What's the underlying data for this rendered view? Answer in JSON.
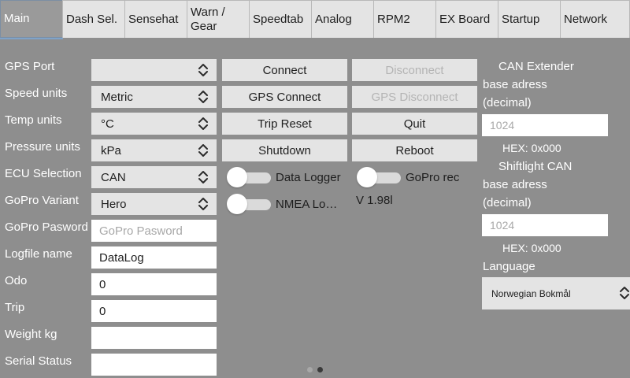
{
  "tabs": [
    {
      "label": "Main",
      "active": true
    },
    {
      "label": "Dash Sel.",
      "active": false
    },
    {
      "label": "Sensehat",
      "active": false
    },
    {
      "label": "Warn / Gear",
      "active": false
    },
    {
      "label": "Speedtab",
      "active": false
    },
    {
      "label": "Analog",
      "active": false
    },
    {
      "label": "RPM2",
      "active": false
    },
    {
      "label": "EX Board",
      "active": false
    },
    {
      "label": "Startup",
      "active": false
    },
    {
      "label": "Network",
      "active": false
    }
  ],
  "settings": {
    "gps_port": {
      "label": "GPS Port",
      "value": ""
    },
    "speed_units": {
      "label": "Speed units",
      "value": "Metric"
    },
    "temp_units": {
      "label": "Temp units",
      "value": "°C"
    },
    "pressure_units": {
      "label": "Pressure units",
      "value": "kPa"
    },
    "ecu_selection": {
      "label": "ECU Selection",
      "value": "CAN"
    },
    "gopro_variant": {
      "label": "GoPro Variant",
      "value": "Hero"
    },
    "gopro_password": {
      "label": "GoPro Pasword",
      "placeholder": "GoPro Pasword"
    },
    "logfile_name": {
      "label": "Logfile name",
      "value": "DataLog"
    },
    "odo": {
      "label": "Odo",
      "value": "0"
    },
    "trip": {
      "label": "Trip",
      "value": "0"
    },
    "weight": {
      "label": "Weight kg",
      "value": ""
    },
    "serial_status": {
      "label": "Serial Status",
      "value": ""
    }
  },
  "buttons": {
    "connect": "Connect",
    "disconnect": "Disconnect",
    "gps_connect": "GPS Connect",
    "gps_disconnect": "GPS Disconnect",
    "trip_reset": "Trip Reset",
    "quit": "Quit",
    "shutdown": "Shutdown",
    "reboot": "Reboot"
  },
  "toggles": {
    "data_logger": {
      "label": "Data Logger",
      "on": false
    },
    "gopro_rec": {
      "label": "GoPro rec",
      "on": false
    },
    "nmea_log": {
      "label": "NMEA Lo…",
      "on": false
    }
  },
  "version": "V 1.98l",
  "can_extender": {
    "title_line1": "CAN Extender",
    "title_line2": "base adress",
    "title_line3": "(decimal)",
    "placeholder": "1024",
    "hex": "HEX: 0x000"
  },
  "shiftlight_can": {
    "title_line1": "Shiftlight CAN",
    "title_line2": "base adress",
    "title_line3": "(decimal)",
    "placeholder": "1024",
    "hex": "HEX: 0x000"
  },
  "language": {
    "label": "Language",
    "value": "Norwegian Bokmål"
  },
  "page_indicator": {
    "count": 2,
    "current": 2
  },
  "colors": {
    "background": "#8e8e8e",
    "control": "#e4e4e4",
    "accent": "#7fa3c9"
  }
}
